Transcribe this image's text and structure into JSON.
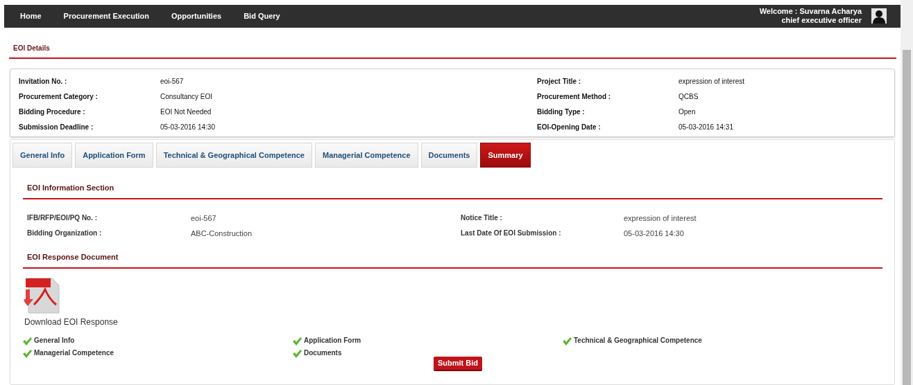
{
  "nav": {
    "items": [
      "Home",
      "Procurement Execution",
      "Opportunities",
      "Bid Query"
    ],
    "welcome": "Welcome : Suvarna Acharya",
    "role": "chief executive officer"
  },
  "page_title": "EOI Details",
  "details": [
    {
      "label": "Invitation No. :",
      "value": "eoi-567"
    },
    {
      "label": "Project Title :",
      "value": "expression of interest"
    },
    {
      "label": "Procurement Category :",
      "value": "Consultancy EOI"
    },
    {
      "label": "Procurement Method :",
      "value": "QCBS"
    },
    {
      "label": "Bidding Procedure :",
      "value": "EOI Not Needed"
    },
    {
      "label": "Bidding Type :",
      "value": "Open"
    },
    {
      "label": "Submission Deadline :",
      "value": "05-03-2016 14:30"
    },
    {
      "label": "EOI-Opening Date :",
      "value": "05-03-2016 14:31"
    }
  ],
  "tabs": [
    {
      "label": "General Info",
      "selected": false
    },
    {
      "label": "Application Form",
      "selected": false
    },
    {
      "label": "Technical & Geographical Competence",
      "selected": false
    },
    {
      "label": "Managerial Competence",
      "selected": false
    },
    {
      "label": "Documents",
      "selected": false
    },
    {
      "label": "Summary",
      "selected": true
    }
  ],
  "info_section": {
    "title": "EOI Information Section",
    "fields": [
      {
        "label": "IFB/RFP/EOI/PQ No. :",
        "value": "eoi-567"
      },
      {
        "label": "Notice Title :",
        "value": "expression of interest"
      },
      {
        "label": "Bidding Organization :",
        "value": "ABC-Construction"
      },
      {
        "label": "Last Date Of EOI Submission :",
        "value": "05-03-2016 14:30"
      }
    ]
  },
  "response_section": {
    "title": "EOI Response Document",
    "download_label": "Download EOI Response"
  },
  "checklist": [
    {
      "label": "General Info",
      "completed": true
    },
    {
      "label": "Application Form",
      "completed": true
    },
    {
      "label": "Technical & Geographical Competence",
      "completed": true
    },
    {
      "label": "Managerial Competence",
      "completed": true
    },
    {
      "label": "Documents",
      "completed": true
    }
  ],
  "submit_button": "Submit Bid"
}
